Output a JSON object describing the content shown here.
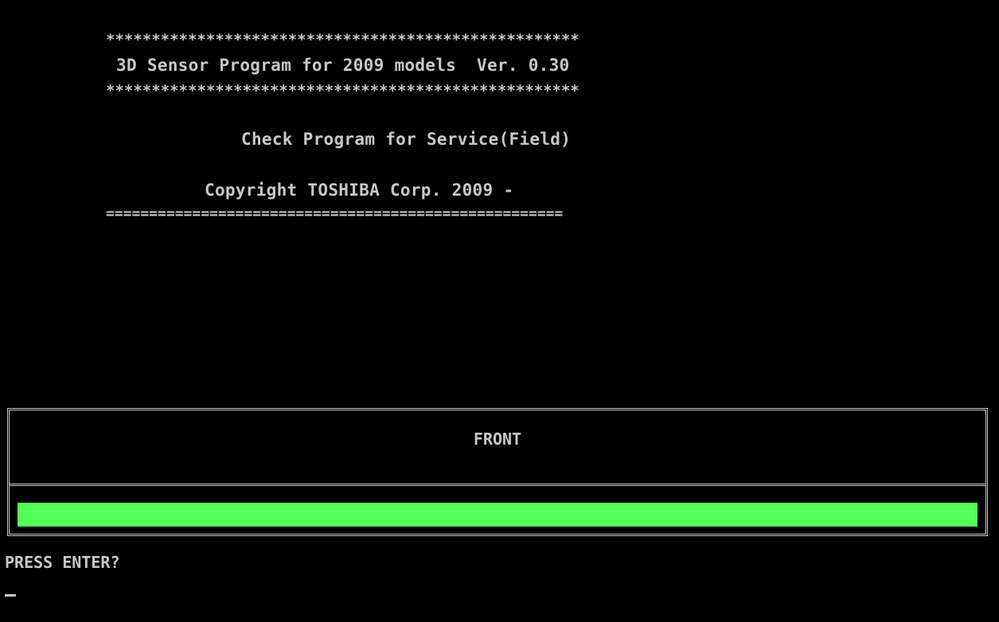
{
  "header": {
    "stars_top": "****************************************************",
    "program_title": "3D Sensor Program for 2009 models  Ver. 0.30",
    "stars_bottom": "****************************************************",
    "subtitle": "Check Program for Service(Field)",
    "copyright": "Copyright TOSHIBA Corp. 2009 -",
    "rule": "====================================================="
  },
  "panel": {
    "title": "FRONT",
    "progress_fraction": 1.0,
    "progress_color": "#55ff55"
  },
  "prompt": {
    "text": "PRESS ENTER?"
  },
  "colors": {
    "background": "#000000",
    "text": "#c8c8c8"
  }
}
